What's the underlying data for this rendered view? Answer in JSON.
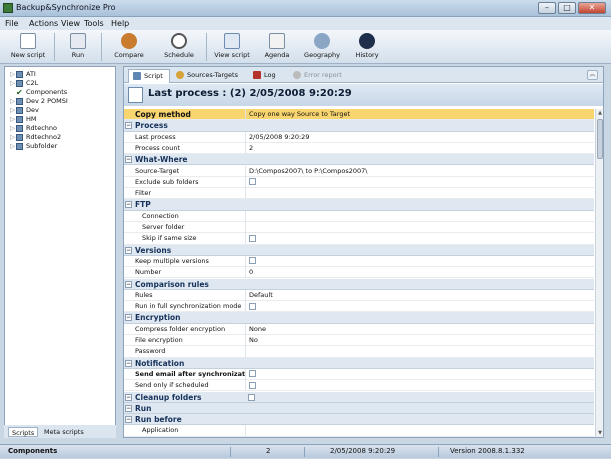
{
  "window": {
    "title": "Backup&Synchronize Pro"
  },
  "menu": [
    "File",
    "Actions",
    "View",
    "Tools",
    "Help"
  ],
  "toolbar": [
    {
      "label": "New script",
      "icon": "new-script-icon"
    },
    {
      "label": "Run",
      "icon": "run-icon"
    },
    {
      "label": "Compare",
      "icon": "compare-icon"
    },
    {
      "label": "Schedule",
      "icon": "schedule-icon"
    },
    {
      "label": "View script",
      "icon": "view-script-icon"
    },
    {
      "label": "Agenda",
      "icon": "agenda-icon"
    },
    {
      "label": "Geography",
      "icon": "geography-icon"
    },
    {
      "label": "History",
      "icon": "history-icon"
    }
  ],
  "tree": [
    {
      "label": "ATI",
      "checked": false
    },
    {
      "label": "C2L",
      "checked": false
    },
    {
      "label": "Components",
      "checked": true
    },
    {
      "label": "Dev 2 POMSI",
      "checked": false
    },
    {
      "label": "Dev",
      "checked": false
    },
    {
      "label": "HM",
      "checked": false
    },
    {
      "label": "Rdtechno",
      "checked": false
    },
    {
      "label": "Rdtechno2",
      "checked": false
    },
    {
      "label": "Subfolder",
      "checked": false
    }
  ],
  "left_tabs": [
    "Scripts",
    "Meta scripts"
  ],
  "right_tabs": [
    {
      "label": "Script",
      "active": true
    },
    {
      "label": "Sources-Targets",
      "active": false
    },
    {
      "label": "Log",
      "active": false
    },
    {
      "label": "Error report",
      "active": false
    }
  ],
  "header": {
    "title": "Last process :  (2)  2/05/2008 9:20:29"
  },
  "grid": [
    {
      "type": "sel",
      "label": "Copy method",
      "value": "Copy one way  Source to Target"
    },
    {
      "type": "cat",
      "label": "Process"
    },
    {
      "type": "item",
      "label": "Last process",
      "value": "2/05/2008 9:20:29"
    },
    {
      "type": "item",
      "label": "Process count",
      "value": "2"
    },
    {
      "type": "cat",
      "label": "What-Where"
    },
    {
      "type": "item",
      "label": "Source-Target",
      "value": "D:\\Compos2007\\ to P:\\Compos2007\\"
    },
    {
      "type": "item",
      "label": "Exclude sub folders",
      "value": "",
      "box": true
    },
    {
      "type": "item",
      "label": "Filter",
      "value": ""
    },
    {
      "type": "cat",
      "label": "FTP"
    },
    {
      "type": "sub",
      "label": "Connection",
      "value": ""
    },
    {
      "type": "sub",
      "label": "Server folder",
      "value": ""
    },
    {
      "type": "sub",
      "label": "Skip if same size",
      "value": "",
      "box": true
    },
    {
      "type": "cat",
      "label": "Versions"
    },
    {
      "type": "item",
      "label": "Keep multiple versions",
      "value": "",
      "box": true
    },
    {
      "type": "item",
      "label": "Number",
      "value": "0"
    },
    {
      "type": "cat",
      "label": "Comparison rules"
    },
    {
      "type": "item",
      "label": "Rules",
      "value": "Default"
    },
    {
      "type": "item",
      "label": "Run in full synchronization mode",
      "value": "",
      "box": true
    },
    {
      "type": "cat",
      "label": "Encryption"
    },
    {
      "type": "item",
      "label": "Compress folder encryption",
      "value": "None"
    },
    {
      "type": "item",
      "label": "File encryption",
      "value": "No"
    },
    {
      "type": "item",
      "label": "Password",
      "value": ""
    },
    {
      "type": "cat",
      "label": "Notification"
    },
    {
      "type": "item",
      "label": "Send email after synchronizati...",
      "value": "",
      "box": true,
      "bold": true
    },
    {
      "type": "item",
      "label": "Send only if scheduled",
      "value": "",
      "box": true
    },
    {
      "type": "cat",
      "label": "Cleanup folders",
      "value": "",
      "box": true
    },
    {
      "type": "cat",
      "label": "Run"
    },
    {
      "type": "cat",
      "label": "Run before"
    },
    {
      "type": "sub",
      "label": "Application",
      "value": ""
    }
  ],
  "status": {
    "left": "Components",
    "count": "2",
    "datetime": "2/05/2008 9:20:29",
    "version": "Version 2008.8.1.332"
  }
}
